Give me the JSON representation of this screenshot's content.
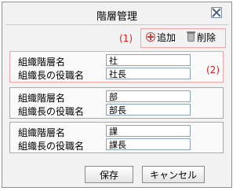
{
  "dialog": {
    "title": "階層管理"
  },
  "toolbar": {
    "callout": "(1)",
    "add_label": "追加",
    "delete_label": "削除"
  },
  "groups": [
    {
      "label1": "組織階層名",
      "value1": "社",
      "label2": "組織長の役職名",
      "value2": "社長",
      "callout": "(2)"
    },
    {
      "label1": "組織階層名",
      "value1": "部",
      "label2": "組織長の役職名",
      "value2": "部長"
    },
    {
      "label1": "組織階層名",
      "value1": "課",
      "label2": "組織長の役職名",
      "value2": "課長"
    }
  ],
  "footer": {
    "save_label": "保存",
    "cancel_label": "キャンセル"
  },
  "colors": {
    "callout": "#e02020",
    "highlight_border": "#f2a5a5"
  },
  "icons": {
    "add": "add-icon",
    "delete": "trash-icon",
    "close": "close-icon"
  }
}
